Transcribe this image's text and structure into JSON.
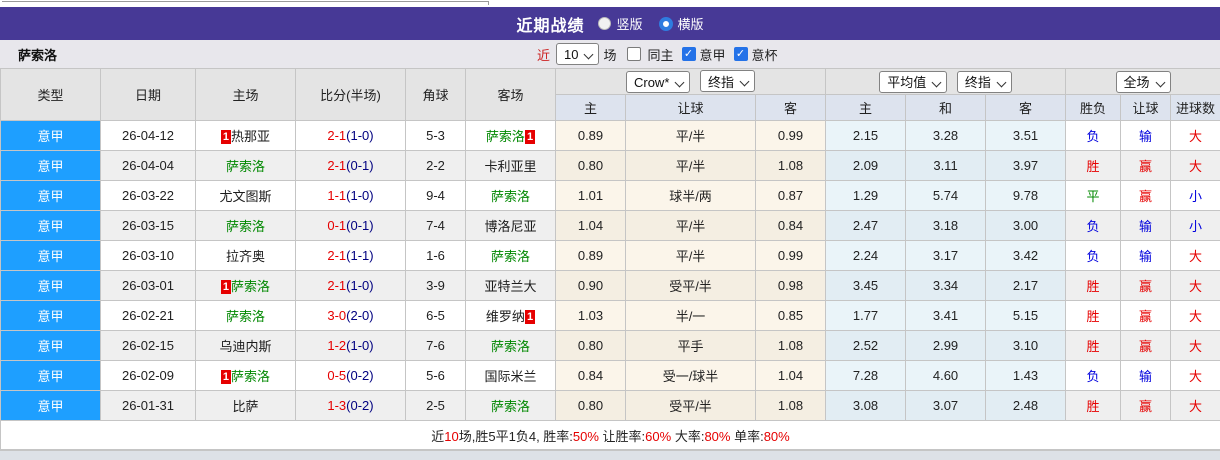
{
  "colors": {
    "title_bar_purple": "#473996",
    "league_badge_blue": "#1e9fff",
    "win_red": "#e60000",
    "loss_blue": "#0000dd",
    "draw_green": "#008800",
    "halftime_navy": "#000080",
    "odds_cream_bg": "#fbf5ea",
    "avg_blue_bg": "#eaf4f9"
  },
  "icons": {
    "check": "✓"
  },
  "title_bar": {
    "title": "近期战绩",
    "radios": [
      {
        "label": "竖版",
        "checked": false
      },
      {
        "label": "横版",
        "checked": true
      }
    ]
  },
  "filter_bar": {
    "team": "萨索洛",
    "near_label": "近",
    "match_count": "10",
    "unit_label": "场",
    "checkboxes": [
      {
        "label": "同主",
        "checked": false
      },
      {
        "label": "意甲",
        "checked": true
      },
      {
        "label": "意杯",
        "checked": true
      }
    ]
  },
  "table": {
    "static_headers": [
      "类型",
      "日期",
      "主场",
      "比分(半场)",
      "角球",
      "客场"
    ],
    "group1_selects": [
      "Crow*",
      "终指"
    ],
    "group2_selects": [
      "平均值",
      "终指"
    ],
    "group3_select": "全场",
    "sub_headers": [
      "主",
      "让球",
      "客",
      "主",
      "和",
      "客",
      "胜负",
      "让球",
      "进球数"
    ],
    "rows": [
      {
        "league": "意甲",
        "date": "26-04-12",
        "home": "热那亚",
        "home_color": "black",
        "home_badge": "1",
        "score": "2-1",
        "half": "(1-0)",
        "corner": "5-3",
        "away": "萨索洛",
        "away_color": "green",
        "away_badge": "1",
        "odds": [
          "0.89",
          "平/半",
          "0.99"
        ],
        "avg": [
          "2.15",
          "3.28",
          "3.51"
        ],
        "result": {
          "wdl": "负",
          "wdl_color": "blue",
          "handicap": "输",
          "handicap_color": "blue",
          "goals": "大",
          "goals_color": "red"
        }
      },
      {
        "league": "意甲",
        "date": "26-04-04",
        "home": "萨索洛",
        "home_color": "green",
        "home_badge": null,
        "score": "2-1",
        "half": "(0-1)",
        "corner": "2-2",
        "away": "卡利亚里",
        "away_color": "black",
        "away_badge": null,
        "odds": [
          "0.80",
          "平/半",
          "1.08"
        ],
        "avg": [
          "2.09",
          "3.11",
          "3.97"
        ],
        "result": {
          "wdl": "胜",
          "wdl_color": "red",
          "handicap": "赢",
          "handicap_color": "red",
          "goals": "大",
          "goals_color": "red"
        }
      },
      {
        "league": "意甲",
        "date": "26-03-22",
        "home": "尤文图斯",
        "home_color": "black",
        "home_badge": null,
        "score": "1-1",
        "half": "(1-0)",
        "corner": "9-4",
        "away": "萨索洛",
        "away_color": "green",
        "away_badge": null,
        "odds": [
          "1.01",
          "球半/两",
          "0.87"
        ],
        "avg": [
          "1.29",
          "5.74",
          "9.78"
        ],
        "result": {
          "wdl": "平",
          "wdl_color": "green",
          "handicap": "赢",
          "handicap_color": "red",
          "goals": "小",
          "goals_color": "blue"
        }
      },
      {
        "league": "意甲",
        "date": "26-03-15",
        "home": "萨索洛",
        "home_color": "green",
        "home_badge": null,
        "score": "0-1",
        "half": "(0-1)",
        "corner": "7-4",
        "away": "博洛尼亚",
        "away_color": "black",
        "away_badge": null,
        "odds": [
          "1.04",
          "平/半",
          "0.84"
        ],
        "avg": [
          "2.47",
          "3.18",
          "3.00"
        ],
        "result": {
          "wdl": "负",
          "wdl_color": "blue",
          "handicap": "输",
          "handicap_color": "blue",
          "goals": "小",
          "goals_color": "blue"
        }
      },
      {
        "league": "意甲",
        "date": "26-03-10",
        "home": "拉齐奥",
        "home_color": "black",
        "home_badge": null,
        "score": "2-1",
        "half": "(1-1)",
        "corner": "1-6",
        "away": "萨索洛",
        "away_color": "green",
        "away_badge": null,
        "odds": [
          "0.89",
          "平/半",
          "0.99"
        ],
        "avg": [
          "2.24",
          "3.17",
          "3.42"
        ],
        "result": {
          "wdl": "负",
          "wdl_color": "blue",
          "handicap": "输",
          "handicap_color": "blue",
          "goals": "大",
          "goals_color": "red"
        }
      },
      {
        "league": "意甲",
        "date": "26-03-01",
        "home": "萨索洛",
        "home_color": "green",
        "home_badge": "1",
        "score": "2-1",
        "half": "(1-0)",
        "corner": "3-9",
        "away": "亚特兰大",
        "away_color": "black",
        "away_badge": null,
        "odds": [
          "0.90",
          "受平/半",
          "0.98"
        ],
        "avg": [
          "3.45",
          "3.34",
          "2.17"
        ],
        "result": {
          "wdl": "胜",
          "wdl_color": "red",
          "handicap": "赢",
          "handicap_color": "red",
          "goals": "大",
          "goals_color": "red"
        }
      },
      {
        "league": "意甲",
        "date": "26-02-21",
        "home": "萨索洛",
        "home_color": "green",
        "home_badge": null,
        "score": "3-0",
        "half": "(2-0)",
        "corner": "6-5",
        "away": "维罗纳",
        "away_color": "black",
        "away_badge": "1",
        "odds": [
          "1.03",
          "半/一",
          "0.85"
        ],
        "avg": [
          "1.77",
          "3.41",
          "5.15"
        ],
        "result": {
          "wdl": "胜",
          "wdl_color": "red",
          "handicap": "赢",
          "handicap_color": "red",
          "goals": "大",
          "goals_color": "red"
        }
      },
      {
        "league": "意甲",
        "date": "26-02-15",
        "home": "乌迪内斯",
        "home_color": "black",
        "home_badge": null,
        "score": "1-2",
        "half": "(1-0)",
        "corner": "7-6",
        "away": "萨索洛",
        "away_color": "green",
        "away_badge": null,
        "odds": [
          "0.80",
          "平手",
          "1.08"
        ],
        "avg": [
          "2.52",
          "2.99",
          "3.10"
        ],
        "result": {
          "wdl": "胜",
          "wdl_color": "red",
          "handicap": "赢",
          "handicap_color": "red",
          "goals": "大",
          "goals_color": "red"
        }
      },
      {
        "league": "意甲",
        "date": "26-02-09",
        "home": "萨索洛",
        "home_color": "green",
        "home_badge": "1",
        "score": "0-5",
        "half": "(0-2)",
        "corner": "5-6",
        "away": "国际米兰",
        "away_color": "black",
        "away_badge": null,
        "odds": [
          "0.84",
          "受一/球半",
          "1.04"
        ],
        "avg": [
          "7.28",
          "4.60",
          "1.43"
        ],
        "result": {
          "wdl": "负",
          "wdl_color": "blue",
          "handicap": "输",
          "handicap_color": "blue",
          "goals": "大",
          "goals_color": "red"
        }
      },
      {
        "league": "意甲",
        "date": "26-01-31",
        "home": "比萨",
        "home_color": "black",
        "home_badge": null,
        "score": "1-3",
        "half": "(0-2)",
        "corner": "2-5",
        "away": "萨索洛",
        "away_color": "green",
        "away_badge": null,
        "odds": [
          "0.80",
          "受平/半",
          "1.08"
        ],
        "avg": [
          "3.08",
          "3.07",
          "2.48"
        ],
        "result": {
          "wdl": "胜",
          "wdl_color": "red",
          "handicap": "赢",
          "handicap_color": "red",
          "goals": "大",
          "goals_color": "red"
        }
      }
    ]
  },
  "footer": {
    "prefix": "近",
    "count": "10",
    "summary": "场,胜5平1负4, 胜率:",
    "win_rate": "50%",
    "handicap_label": " 让胜率:",
    "handicap_rate": "60%",
    "big_label": " 大率:",
    "big_rate": "80%",
    "single_label": " 单率:",
    "single_rate": "80%"
  }
}
